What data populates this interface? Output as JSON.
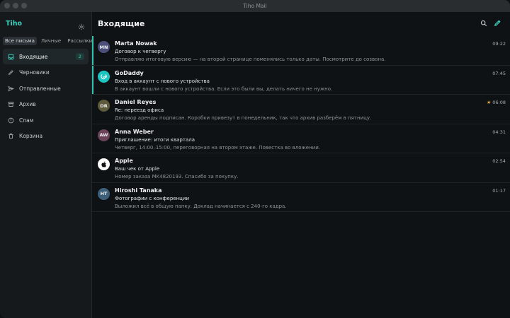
{
  "window": {
    "title": "Tiho Mail"
  },
  "sidebar": {
    "brand": "Tiho",
    "filters": [
      {
        "label": "Все письма",
        "active": true
      },
      {
        "label": "Личные",
        "active": false
      },
      {
        "label": "Рассылки",
        "active": false
      }
    ],
    "items": [
      {
        "label": "Входящие",
        "icon": "inbox-icon",
        "badge": "2",
        "active": true
      },
      {
        "label": "Черновики",
        "icon": "pencil-icon"
      },
      {
        "label": "Отправленные",
        "icon": "send-icon"
      },
      {
        "label": "Архив",
        "icon": "archive-icon"
      },
      {
        "label": "Спам",
        "icon": "alert-icon"
      },
      {
        "label": "Корзина",
        "icon": "trash-icon"
      }
    ]
  },
  "main": {
    "title": "Входящие",
    "accent": "#2ec4b0",
    "messages": [
      {
        "initials": "MN",
        "avatar_color": "#4b4f7a",
        "sender": "Marta Nowak",
        "subject": "Договор к четвергу",
        "preview": "Отправляю итоговую версию — на второй странице поменялись только даты. Посмотрите до созвона.",
        "time": "09:22",
        "unread": true,
        "starred": false
      },
      {
        "initials": "",
        "avatar_color": "#1bc6c1",
        "avatar_icon": "godaddy-logo-icon",
        "sender": "GoDaddy",
        "subject": "Вход в аккаунт с нового устройства",
        "preview": "В аккаунт вошли с нового устройства. Если это были вы, делать ничего не нужно.",
        "time": "07:45",
        "unread": true,
        "starred": false
      },
      {
        "initials": "DR",
        "avatar_color": "#5e5a3c",
        "sender": "Daniel Reyes",
        "subject": "Re: переезд офиса",
        "preview": "Договор аренды подписан. Коробки привезут в понедельник, так что архив разберём в пятницу.",
        "time": "06:08",
        "unread": false,
        "starred": true
      },
      {
        "initials": "AW",
        "avatar_color": "#6b4258",
        "sender": "Anna Weber",
        "subject": "Приглашение: итоги квартала",
        "preview": "Четверг, 14:00–15:00, переговорная на втором этаже. Повестка во вложении.",
        "time": "04:31",
        "unread": false,
        "starred": false
      },
      {
        "initials": "",
        "avatar_color": "#ffffff",
        "avatar_icon": "apple-logo-icon",
        "sender": "Apple",
        "subject": "Ваш чек от Apple",
        "preview": "Номер заказа MK4820193. Спасибо за покупку.",
        "time": "02:54",
        "unread": false,
        "starred": false
      },
      {
        "initials": "HT",
        "avatar_color": "#3d5f7a",
        "sender": "Hiroshi Tanaka",
        "subject": "Фотографии с конференции",
        "preview": "Выложил всё в общую папку. Доклад начинается с 240-го кадра.",
        "time": "01:17",
        "unread": false,
        "starred": false
      }
    ]
  }
}
